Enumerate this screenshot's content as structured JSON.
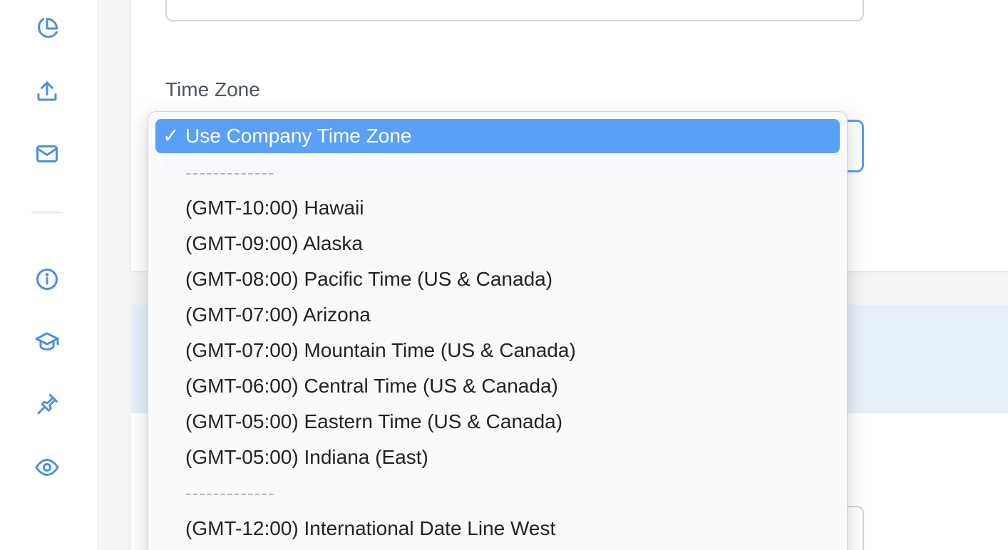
{
  "sidebar": {
    "icons": [
      "pie-chart-icon",
      "upload-icon",
      "mail-icon",
      "info-icon",
      "graduation-cap-icon",
      "pin-icon",
      "eye-icon"
    ]
  },
  "form": {
    "time_zone_label": "Time Zone"
  },
  "dropdown": {
    "selected_check": "✓",
    "selected_label": "Use Company Time Zone",
    "separator": "-------------",
    "options": [
      "(GMT-10:00) Hawaii",
      "(GMT-09:00) Alaska",
      "(GMT-08:00) Pacific Time (US & Canada)",
      "(GMT-07:00) Arizona",
      "(GMT-07:00) Mountain Time (US & Canada)",
      "(GMT-06:00) Central Time (US & Canada)",
      "(GMT-05:00) Eastern Time (US & Canada)",
      "(GMT-05:00) Indiana (East)"
    ],
    "options_after_separator": [
      "(GMT-12:00) International Date Line West"
    ]
  },
  "colors": {
    "accent": "#5aa0fa",
    "icon": "#4a90e2"
  }
}
